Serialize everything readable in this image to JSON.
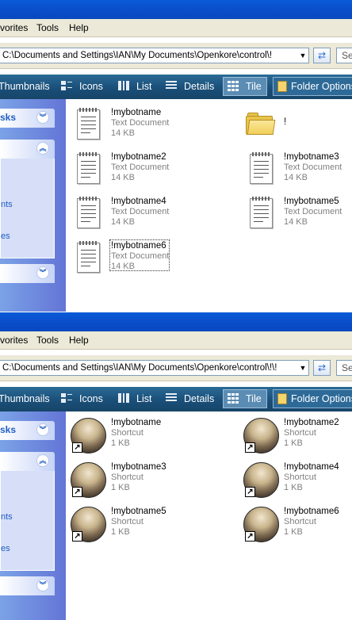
{
  "colors": {
    "xp_blue": "#0a4cc8",
    "view_bar": "#1a4f79",
    "task_link": "#215dc6",
    "meta_text": "#808080"
  },
  "windows": [
    {
      "menu": [
        "vorites",
        "Tools",
        "Help"
      ],
      "address": "C:\\Documents and Settings\\IAN\\My Documents\\Openkore\\control\\!",
      "search_label": "Se",
      "views": {
        "thumbnails": "Thumbnails",
        "icons": "Icons",
        "list": "List",
        "details": "Details",
        "tile": "Tile",
        "folder_options": "Folder Options"
      },
      "task_pane": {
        "header1": "sks",
        "link1": "nts",
        "link2": "es"
      },
      "items": [
        {
          "name": "!mybotname",
          "type": "Text Document",
          "size": "14 KB",
          "icon": "notepad-document-icon"
        },
        {
          "name": "!",
          "type": "",
          "size": "",
          "icon": "folder-icon"
        },
        {
          "name": "!mybotname2",
          "type": "Text Document",
          "size": "14 KB",
          "icon": "notepad-document-icon"
        },
        {
          "name": "!mybotname3",
          "type": "Text Document",
          "size": "14 KB",
          "icon": "notepad-document-icon"
        },
        {
          "name": "!mybotname4",
          "type": "Text Document",
          "size": "14 KB",
          "icon": "notepad-document-icon"
        },
        {
          "name": "!mybotname5",
          "type": "Text Document",
          "size": "14 KB",
          "icon": "notepad-document-icon"
        },
        {
          "name": "!mybotname6",
          "type": "Text Document",
          "size": "14 KB",
          "icon": "notepad-document-icon",
          "selected": true
        }
      ]
    },
    {
      "menu": [
        "vorites",
        "Tools",
        "Help"
      ],
      "address": "C:\\Documents and Settings\\IAN\\My Documents\\Openkore\\control\\!\\!",
      "search_label": "Se",
      "views": {
        "thumbnails": "Thumbnails",
        "icons": "Icons",
        "list": "List",
        "details": "Details",
        "tile": "Tile",
        "folder_options": "Folder Options"
      },
      "task_pane": {
        "header1": "sks",
        "link1": "nts",
        "link2": "es"
      },
      "items": [
        {
          "name": "!mybotname",
          "type": "Shortcut",
          "size": "1 KB",
          "icon": "shortcut-icon"
        },
        {
          "name": "!mybotname2",
          "type": "Shortcut",
          "size": "1 KB",
          "icon": "shortcut-icon"
        },
        {
          "name": "!mybotname3",
          "type": "Shortcut",
          "size": "1 KB",
          "icon": "shortcut-icon"
        },
        {
          "name": "!mybotname4",
          "type": "Shortcut",
          "size": "1 KB",
          "icon": "shortcut-icon"
        },
        {
          "name": "!mybotname5",
          "type": "Shortcut",
          "size": "1 KB",
          "icon": "shortcut-icon"
        },
        {
          "name": "!mybotname6",
          "type": "Shortcut",
          "size": "1 KB",
          "icon": "shortcut-icon"
        }
      ]
    }
  ]
}
